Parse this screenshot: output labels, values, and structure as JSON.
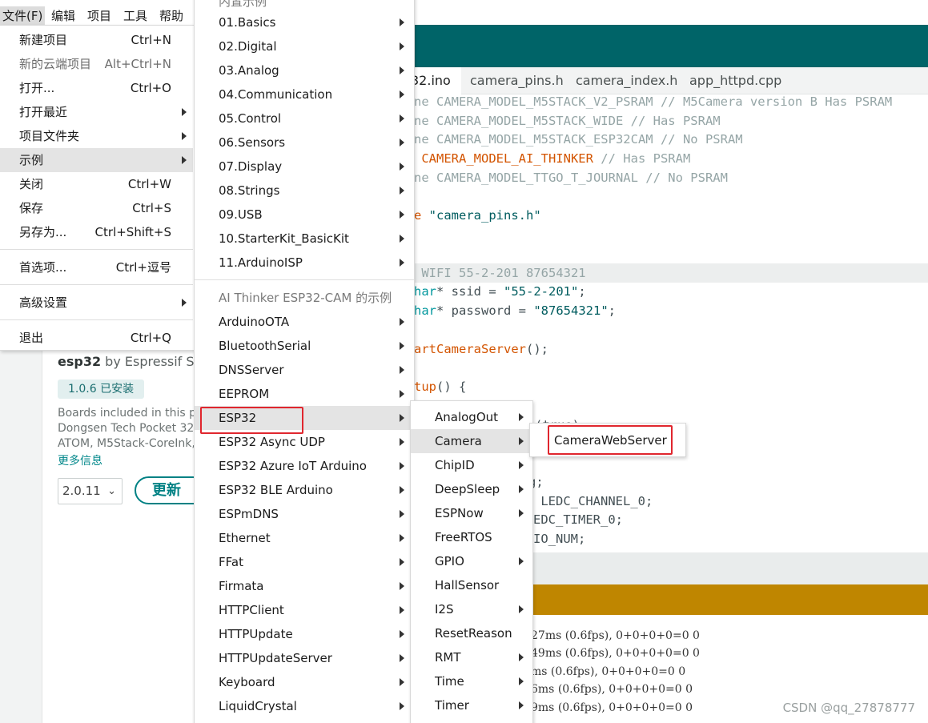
{
  "menubar": {
    "items": [
      "文件(F)",
      "编辑",
      "项目",
      "工具",
      "帮助"
    ]
  },
  "file_menu": {
    "items": [
      {
        "label": "新建项目",
        "shortcut": "Ctrl+N"
      },
      {
        "label": "新的云端项目",
        "shortcut": "Alt+Ctrl+N"
      },
      {
        "label": "打开...",
        "shortcut": "Ctrl+O"
      },
      {
        "label": "打开最近",
        "shortcut": ""
      },
      {
        "label": "项目文件夹",
        "shortcut": ""
      },
      {
        "label": "示例",
        "shortcut": ""
      },
      {
        "label": "关闭",
        "shortcut": "Ctrl+W"
      },
      {
        "label": "保存",
        "shortcut": "Ctrl+S"
      },
      {
        "label": "另存为...",
        "shortcut": "Ctrl+Shift+S"
      },
      {
        "label": "首选项...",
        "shortcut": "Ctrl+逗号"
      },
      {
        "label": "高级设置",
        "shortcut": ""
      },
      {
        "label": "退出",
        "shortcut": "Ctrl+Q"
      }
    ]
  },
  "examples_menu": {
    "builtin_header": "内置示例",
    "builtin": [
      "01.Basics",
      "02.Digital",
      "03.Analog",
      "04.Communication",
      "05.Control",
      "06.Sensors",
      "07.Display",
      "08.Strings",
      "09.USB",
      "10.StarterKit_BasicKit",
      "11.ArduinoISP"
    ],
    "board_header": "AI Thinker ESP32-CAM 的示例",
    "board": [
      "ArduinoOTA",
      "BluetoothSerial",
      "DNSServer",
      "EEPROM",
      "ESP32",
      "ESP32 Async UDP",
      "ESP32 Azure IoT Arduino",
      "ESP32 BLE Arduino",
      "ESPmDNS",
      "Ethernet",
      "FFat",
      "Firmata",
      "HTTPClient",
      "HTTPUpdate",
      "HTTPUpdateServer",
      "Keyboard",
      "LiquidCrystal"
    ]
  },
  "esp32_menu": {
    "items": [
      "AnalogOut",
      "Camera",
      "ChipID",
      "DeepSleep",
      "ESPNow",
      "FreeRTOS",
      "GPIO",
      "HallSensor",
      "I2S",
      "ResetReason",
      "RMT",
      "Time",
      "Timer"
    ]
  },
  "camera_menu": {
    "items": [
      "CameraWebServer"
    ]
  },
  "tabs": [
    "32.ino",
    "camera_pins.h",
    "camera_index.h",
    "app_httpd.cpp"
  ],
  "code": {
    "l1": {
      "a": "ne CAMERA_MODEL_M5STACK_V2_PSRAM ",
      "b": "// M5Camera version B Has PSRAM"
    },
    "l2": {
      "a": "ne CAMERA_MODEL_M5STACK_WIDE ",
      "b": "// Has PSRAM"
    },
    "l3": {
      "a": "ne CAMERA_MODEL_M5STACK_ESP32CAM ",
      "b": "// No PSRAM"
    },
    "l4": {
      "a": " CAMERA_MODEL_AI_THINKER",
      "b": " // Has PSRAM"
    },
    "l5": {
      "a": "ne CAMERA_MODEL_TTGO_T_JOURNAL ",
      "b": "// No PSRAM"
    },
    "l6": {
      "a": "e ",
      "b": "\"camera_pins.h\""
    },
    "l7": " WIFI 55-2-201 87654321",
    "l8": {
      "a": "har",
      "b": "* ssid = ",
      "c": "\"55-2-201\"",
      "d": ";"
    },
    "l9": {
      "a": "har",
      "b": "* password = ",
      "c": "\"87654321\"",
      "d": ";"
    },
    "l10": {
      "a": "artCameraServer",
      "b": "();"
    },
    "l11": {
      "a": "tup",
      "b": "() {"
    },
    "l12": "(true);",
    "l13": "g;",
    "l14": " LEDC_CHANNEL_0;",
    "l15": "EDC_TIMER_0;",
    "l16": "IO_NUM;"
  },
  "console_lines": [
    "27ms (0.6fps), 0+0+0+0=0 0",
    "49ms (0.6fps), 0+0+0+0=0 0",
    "ms (0.6fps), 0+0+0+0=0 0",
    "6ms (0.6fps), 0+0+0+0=0 0",
    "9ms (0.6fps), 0+0+0+0=0 0"
  ],
  "board_panel": {
    "name": "esp32",
    "by": " by Espressif Sys",
    "installed": "1.0.6 已安装",
    "desc1": "Boards included in this p",
    "desc2": "Dongsen Tech Pocket 32",
    "desc3": "ATOM, M5Stack-CoreInk,",
    "more": "更多信息",
    "version": "2.0.11",
    "update": "更新"
  },
  "watermark": "CSDN @qq_27878777",
  "colors": {
    "toolbar": "#006468",
    "console_header": "#bf8600",
    "highlight_box": "#e0262e",
    "accent": "#008184"
  }
}
